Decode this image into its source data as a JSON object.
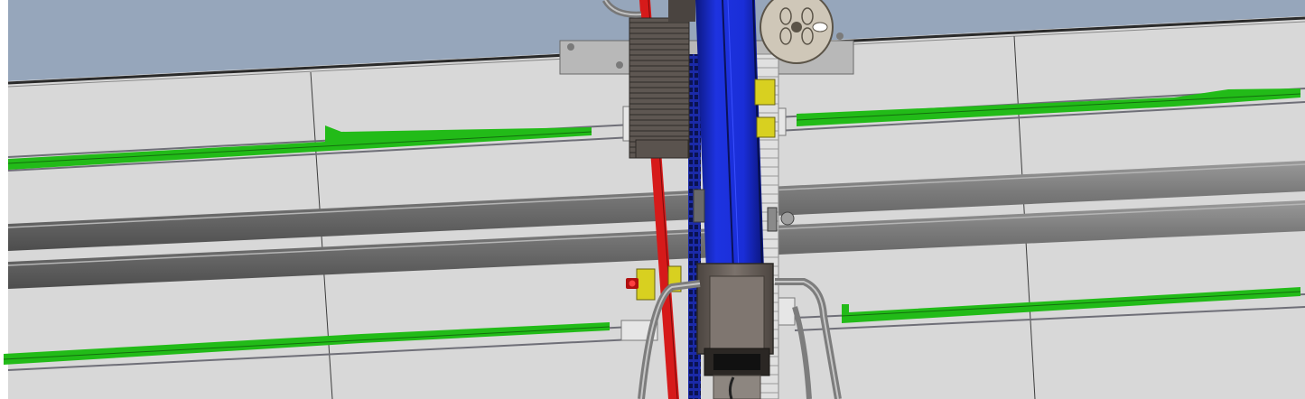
{
  "scene": {
    "kind": "cad-assembly-view",
    "labels": [],
    "colors": {
      "background": "#ffffff",
      "sky": "#96a6bb",
      "wall": "#d9d9d9",
      "wall_line": "#505050",
      "green_rail": "#22bb18",
      "rail_edge": "#1a4d1a",
      "pipe": "#6b6b6b",
      "pipe_highlight": "#8f8f8f",
      "pipe_shadow": "#4a4a4a",
      "blue_column": "#1a2ed8",
      "blue_dark": "#0e1a7a",
      "red_strip": "#d61a1a",
      "motor_body": "#6a625d",
      "bracket_metal": "#bdbdbd",
      "yellow_part": "#d8d020",
      "grille": "#3a3a3a"
    },
    "icons": [
      "gear-disc-icon",
      "warning-light-icon"
    ]
  }
}
